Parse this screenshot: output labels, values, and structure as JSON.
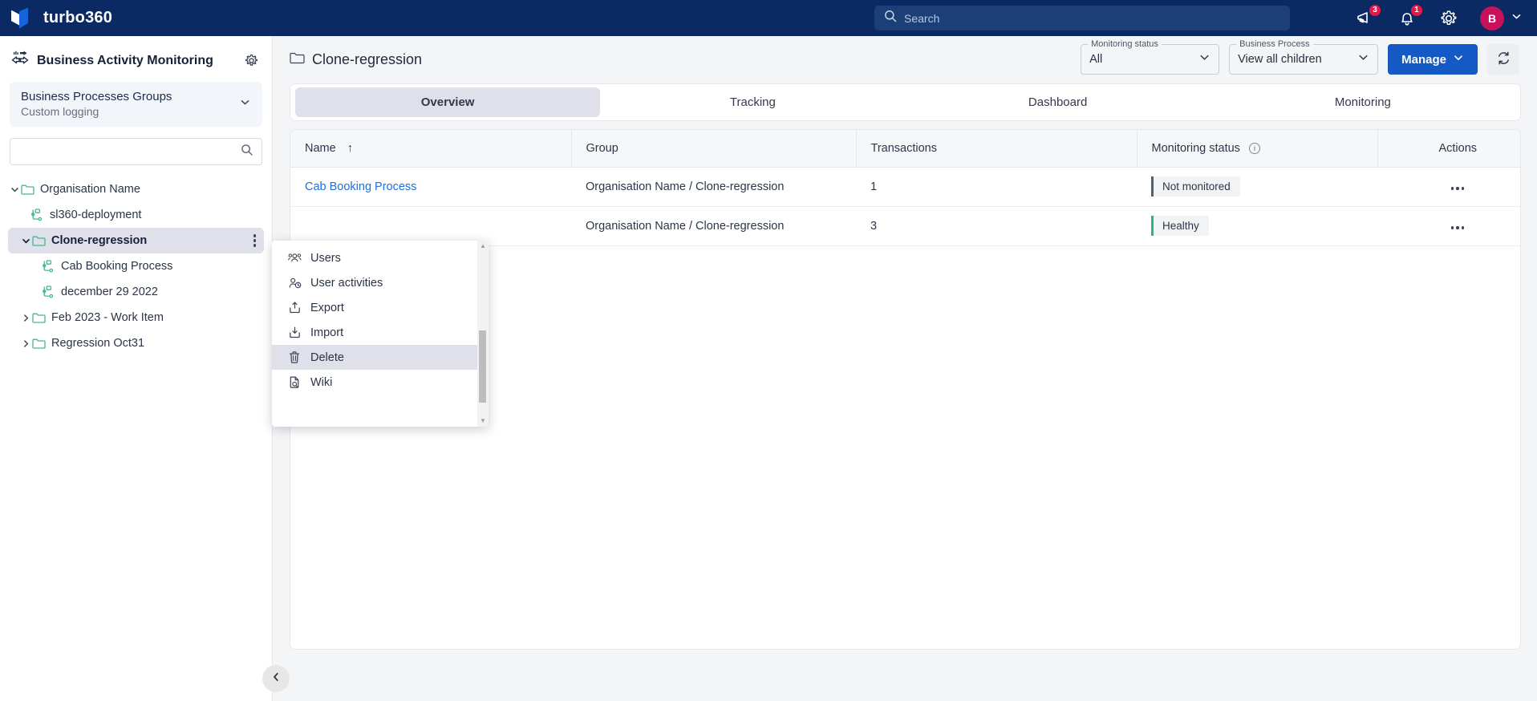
{
  "topbar": {
    "brand": "turbo360",
    "logo_icon": "turbo360-logo-icon",
    "search": {
      "placeholder": "Search",
      "value": "",
      "icon": "search-icon"
    },
    "announcements": {
      "icon": "megaphone-icon",
      "badge": "3"
    },
    "notifications": {
      "icon": "bell-icon",
      "badge": "1"
    },
    "settings": {
      "icon": "gear-icon"
    },
    "account": {
      "initial": "B",
      "chevron_icon": "chevron-down-icon"
    },
    "colors": {
      "bg": "#0b2a63",
      "search_bg": "#1b3f76",
      "badge": "#e8174a",
      "avatar": "#c8115b"
    }
  },
  "sidebar": {
    "title": "Business Activity Monitoring",
    "title_icon": "bam-exchange-icon",
    "settings_icon": "gear-icon",
    "group": {
      "name": "Business Processes Groups",
      "subtitle": "Custom logging",
      "chevron_icon": "chevron-down-icon"
    },
    "search": {
      "placeholder": "",
      "value": "",
      "icon": "search-icon"
    },
    "tree": [
      {
        "label": "Organisation Name",
        "icon": "folder-icon",
        "expander": "chevron-down-icon",
        "indent": 0,
        "selected": false,
        "has_menu": false
      },
      {
        "label": "sl360-deployment",
        "icon": "process-flow-icon",
        "expander": "none",
        "indent": 1,
        "selected": false,
        "has_menu": false
      },
      {
        "label": "Clone-regression",
        "icon": "folder-icon",
        "expander": "chevron-down-icon",
        "indent": 1,
        "selected": true,
        "has_menu": true
      },
      {
        "label": "Cab Booking Process",
        "icon": "process-flow-icon",
        "expander": "none",
        "indent": 2,
        "selected": false,
        "has_menu": false
      },
      {
        "label": "december 29 2022",
        "icon": "process-flow-icon",
        "expander": "none",
        "indent": 2,
        "selected": false,
        "has_menu": false
      },
      {
        "label": "Feb 2023 - Work Item",
        "icon": "folder-icon",
        "expander": "chevron-right-icon",
        "indent": 1,
        "selected": false,
        "has_menu": false
      },
      {
        "label": "Regression Oct31",
        "icon": "folder-icon",
        "expander": "chevron-right-icon",
        "indent": 1,
        "selected": false,
        "has_menu": false
      }
    ],
    "collapse_icon": "chevron-left-icon"
  },
  "context_menu": {
    "items": [
      {
        "label": "Users",
        "icon": "users-icon",
        "highlighted": false
      },
      {
        "label": "User activities",
        "icon": "user-clock-icon",
        "highlighted": false
      },
      {
        "label": "Export",
        "icon": "export-upload-icon",
        "highlighted": false
      },
      {
        "label": "Import",
        "icon": "import-download-icon",
        "highlighted": false
      },
      {
        "label": "Delete",
        "icon": "trash-icon",
        "highlighted": true
      },
      {
        "label": "Wiki",
        "icon": "document-search-icon",
        "highlighted": false
      }
    ],
    "scrollbar": {
      "up_icon": "caret-up-icon",
      "down_icon": "caret-down-icon"
    }
  },
  "main": {
    "page_title": "Clone-regression",
    "page_title_icon": "folder-icon",
    "filters": [
      {
        "label": "Monitoring status",
        "value": "All",
        "chevron_icon": "chevron-down-icon"
      },
      {
        "label": "Business Process",
        "value": "View all children",
        "chevron_icon": "chevron-down-icon"
      }
    ],
    "manage_button": {
      "label": "Manage",
      "chevron_icon": "chevron-down-icon",
      "color": "#1459c4"
    },
    "refresh_button": {
      "icon": "refresh-icon"
    },
    "tabs": [
      {
        "label": "Overview",
        "active": true
      },
      {
        "label": "Tracking",
        "active": false
      },
      {
        "label": "Dashboard",
        "active": false
      },
      {
        "label": "Monitoring",
        "active": false
      }
    ],
    "table": {
      "headers": {
        "name": "Name",
        "name_sort_icon": "sort-ascending-arrow",
        "group": "Group",
        "transactions": "Transactions",
        "status": "Monitoring status",
        "status_info_icon": "info-icon",
        "actions": "Actions"
      },
      "rows": [
        {
          "name": "Cab Booking Process",
          "name_is_link": true,
          "group": "Organisation Name / Clone-regression",
          "transactions": "1",
          "status": "Not monitored",
          "status_color": "#55606f",
          "actions_icon": "more-horizontal-icon"
        },
        {
          "name": "",
          "name_is_link": true,
          "group": "Organisation Name / Clone-regression",
          "transactions": "3",
          "status": "Healthy",
          "status_color": "#2cb67d",
          "actions_icon": "more-horizontal-icon"
        }
      ]
    }
  }
}
